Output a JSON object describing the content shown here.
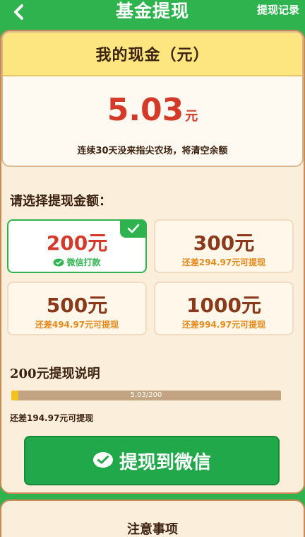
{
  "header": {
    "title": "基金提现",
    "record_label": "提现记录",
    "back_icon": "chevron-left-icon"
  },
  "cash": {
    "title": "我的现金（元）",
    "amount": "5.03",
    "unit": "元",
    "note": "连续30天没来指尖农场，将清空余额"
  },
  "choose_label": "请选择提现金额：",
  "options": [
    {
      "amount": "200元",
      "sub": "微信打款",
      "selected": true
    },
    {
      "amount": "300元",
      "sub": "还差294.97元可提现",
      "selected": false
    },
    {
      "amount": "500元",
      "sub": "还差494.97元可提现",
      "selected": false
    },
    {
      "amount": "1000元",
      "sub": "还差994.97元可提现",
      "selected": false
    }
  ],
  "explain": {
    "title": "200元提现说明",
    "progress_text": "5.03/200",
    "progress_fraction": 0.025,
    "remain": "还差194.97元可提现"
  },
  "withdraw_button": {
    "label": "提现到微信",
    "icon": "wechat-icon"
  },
  "notice_title": "注意事项",
  "colors": {
    "green": "#2fb34f",
    "red": "#d43a2a",
    "orange": "#e58a1a",
    "cream": "#fbeedb",
    "yellow": "#fde680"
  }
}
